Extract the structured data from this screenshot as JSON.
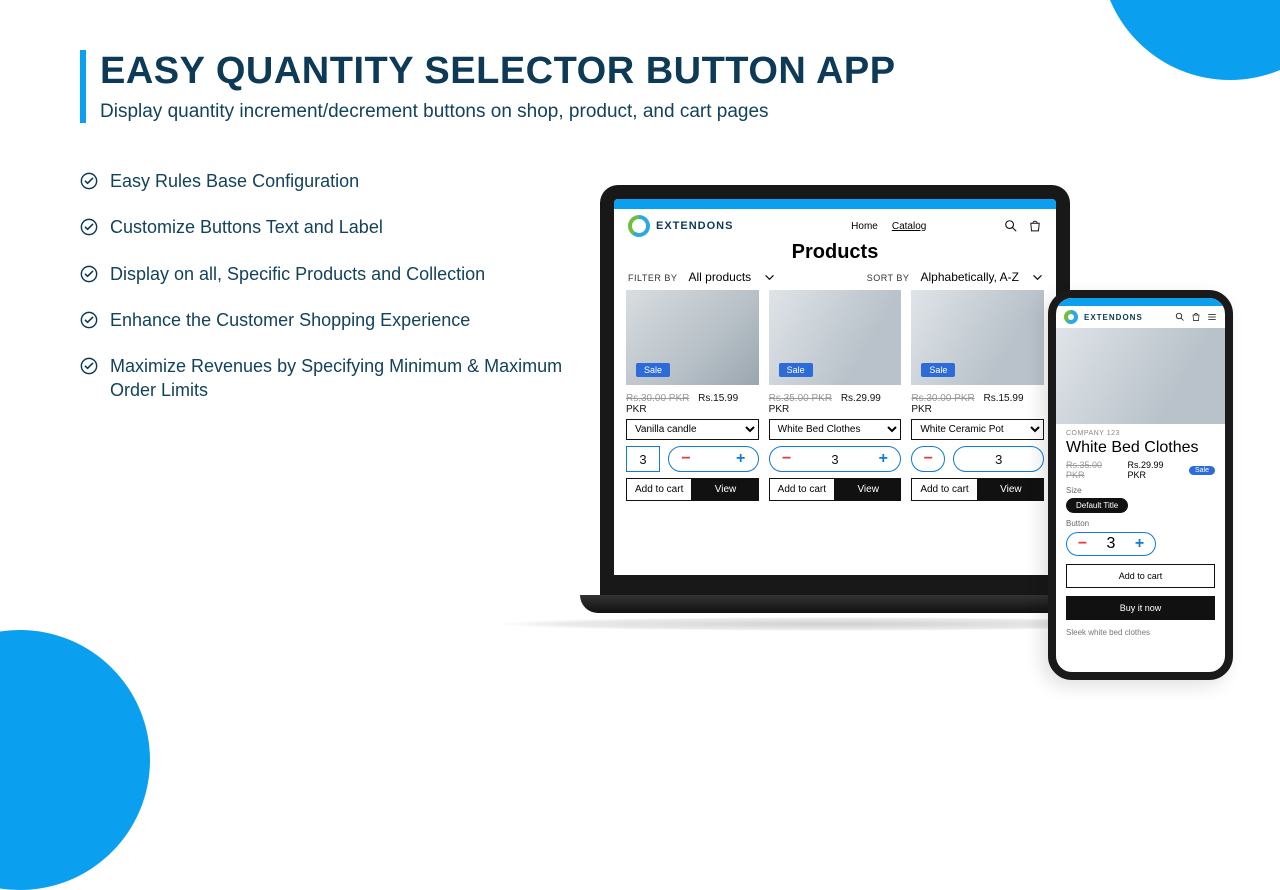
{
  "hero": {
    "title": "EASY QUANTITY SELECTOR BUTTON APP",
    "subtitle": "Display quantity increment/decrement buttons on shop, product, and cart pages"
  },
  "features": [
    "Easy Rules Base Configuration",
    "Customize Buttons Text and Label",
    "Display on all, Specific Products and Collection",
    "Enhance the Customer Shopping Experience",
    "Maximize Revenues by Specifying Minimum & Maximum Order Limits"
  ],
  "brand": {
    "name": "EXTENDONS"
  },
  "shop": {
    "nav": {
      "home": "Home",
      "catalog": "Catalog"
    },
    "title": "Products",
    "filter_label": "FILTER BY",
    "filter_value": "All products",
    "sort_label": "SORT BY",
    "sort_value": "Alphabetically, A-Z",
    "sale_label": "Sale",
    "add_to_cart": "Add to cart",
    "view": "View",
    "products": [
      {
        "old_price": "Rs.30.00 PKR",
        "new_price": "Rs.15.99 PKR",
        "variant": "Vanilla candle",
        "qty": "3"
      },
      {
        "old_price": "Rs.35.00 PKR",
        "new_price": "Rs.29.99 PKR",
        "variant": "White Bed Clothes",
        "qty": "3"
      },
      {
        "old_price": "Rs.30.00 PKR",
        "new_price": "Rs.15.99 PKR",
        "variant": "White Ceramic Pot",
        "qty": "3"
      }
    ]
  },
  "phone": {
    "company": "COMPANY 123",
    "title": "White Bed Clothes",
    "old_price": "Rs.35.00 PKR",
    "new_price": "Rs.29.99 PKR",
    "sale": "Sale",
    "size_label": "Size",
    "size_value": "Default Title",
    "button_label": "Button",
    "qty": "3",
    "add_to_cart": "Add to cart",
    "buy_now": "Buy it now",
    "desc": "Sleek white bed clothes"
  }
}
